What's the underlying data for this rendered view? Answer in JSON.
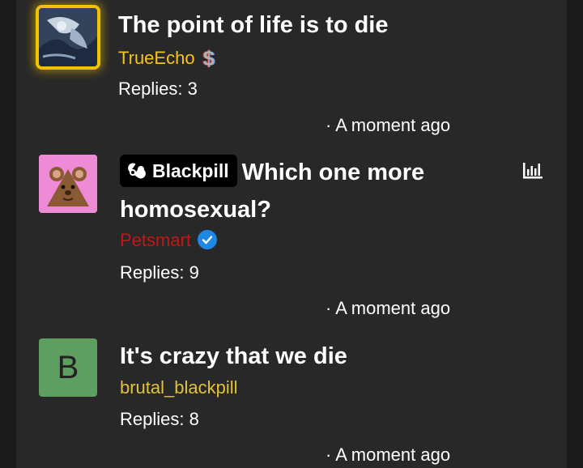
{
  "threads": [
    {
      "title": "The point of life is to die",
      "author": "TrueEcho",
      "author_color": "#f5c518",
      "author_icon": "dollar-icon",
      "replies_label": "Replies: 3",
      "time": "· A moment ago"
    },
    {
      "badge_label": "Blackpill",
      "badge_icon": "pill-icon",
      "title": "Which one more homosexual?",
      "author": "Petsmart",
      "author_color": "#c01818",
      "author_icon": "verified-check-icon",
      "replies_label": "Replies: 9",
      "time": "· A moment ago",
      "poll_icon": "poll-chart-icon"
    },
    {
      "avatar_letter": "B",
      "title": "It's crazy that we die",
      "author": "brutal_blackpill",
      "author_color": "#e2c23a",
      "replies_label": "Replies: 8",
      "time": "· A moment ago"
    }
  ]
}
